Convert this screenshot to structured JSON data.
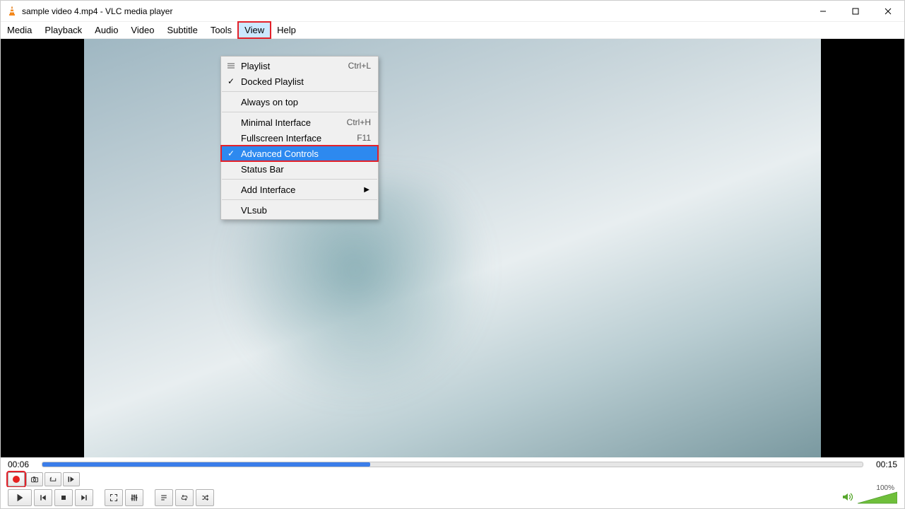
{
  "title": "sample video 4.mp4 - VLC media player",
  "menubar": [
    "Media",
    "Playback",
    "Audio",
    "Video",
    "Subtitle",
    "Tools",
    "View",
    "Help"
  ],
  "view_menu": {
    "items": [
      {
        "label": "Playlist",
        "accel": "Ctrl+L",
        "checked": false,
        "icon": "list"
      },
      {
        "label": "Docked Playlist",
        "accel": "",
        "checked": true
      },
      {
        "sep": true
      },
      {
        "label": "Always on top",
        "accel": "",
        "checked": false
      },
      {
        "sep": true
      },
      {
        "label": "Minimal Interface",
        "accel": "Ctrl+H",
        "checked": false
      },
      {
        "label": "Fullscreen Interface",
        "accel": "F11",
        "checked": false
      },
      {
        "label": "Advanced Controls",
        "accel": "",
        "checked": true,
        "highlight": true
      },
      {
        "label": "Status Bar",
        "accel": "",
        "checked": false
      },
      {
        "sep": true
      },
      {
        "label": "Add Interface",
        "accel": "",
        "submenu": true
      },
      {
        "sep": true
      },
      {
        "label": "VLsub",
        "accel": "",
        "checked": false
      }
    ]
  },
  "seek": {
    "elapsed": "00:06",
    "total": "00:15",
    "fill_pct": 40
  },
  "volume": {
    "pct_label": "100%"
  }
}
